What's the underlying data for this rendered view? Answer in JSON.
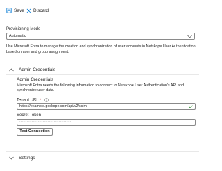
{
  "toolbar": {
    "save_label": "Save",
    "discard_label": "Discard"
  },
  "provisioning_mode": {
    "label": "Provisioning Mode",
    "selected": "Automatic",
    "description": "Use Microsoft Entra to manage the creation and synchronization of user accounts in Netskope User Authentication based on user and group assignment."
  },
  "admin_credentials": {
    "section_title": "Admin Credentials",
    "heading": "Admin Credentials",
    "description": "Microsoft Entra needs the following information to connect to Netskope User Authentication's API and synchronize user data.",
    "tenant_url_label": "Tenant URL",
    "required_mark": "*",
    "tenant_url_value": "https://example.goskope.com/api/v2/scim",
    "secret_token_label": "Secret Token",
    "secret_token_value": "••••••••••••••••••••••••••••••••••••••••••",
    "test_button_label": "Test Connection"
  },
  "settings": {
    "section_title": "Settings"
  },
  "colors": {
    "accent": "#0078d4",
    "valid": "#107c10",
    "required": "#a4262c"
  },
  "icons": {
    "save": "save-icon",
    "discard": "close-icon",
    "chevron": "chevron-icon",
    "info": "info-icon",
    "check": "check-icon"
  }
}
